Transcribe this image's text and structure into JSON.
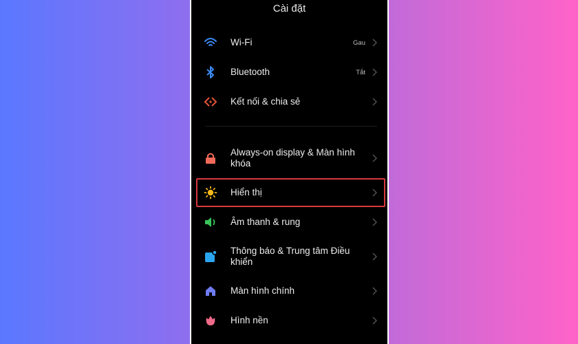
{
  "header": {
    "title": "Cài đặt"
  },
  "groups": [
    {
      "items": [
        {
          "label": "Wi-Fi",
          "value": "Gau",
          "icon": "wifi-icon",
          "color": "#3b8bf5"
        },
        {
          "label": "Bluetooth",
          "value": "Tắt",
          "icon": "bluetooth-icon",
          "color": "#3b8bf5"
        },
        {
          "label": "Kết nối & chia sẻ",
          "value": "",
          "icon": "connection-sharing-icon",
          "color": "#e5533b"
        }
      ]
    },
    {
      "items": [
        {
          "label": "Always-on display & Màn hình khóa",
          "value": "",
          "icon": "lock-icon",
          "color": "#f06a5a"
        },
        {
          "label": "Hiển thị",
          "value": "",
          "icon": "sun-icon",
          "color": "#f6b71c",
          "highlighted": true
        },
        {
          "label": "Âm thanh & rung",
          "value": "",
          "icon": "speaker-icon",
          "color": "#39c45a"
        },
        {
          "label": "Thông báo & Trung tâm Điều khiển",
          "value": "",
          "icon": "notification-icon",
          "color": "#2aa6f0"
        },
        {
          "label": "Màn hình chính",
          "value": "",
          "icon": "home-icon",
          "color": "#6f7cf2"
        },
        {
          "label": "Hình nền",
          "value": "",
          "icon": "wallpaper-icon",
          "color": "#f06a8a"
        }
      ]
    }
  ],
  "highlight_color": "#d9383f"
}
